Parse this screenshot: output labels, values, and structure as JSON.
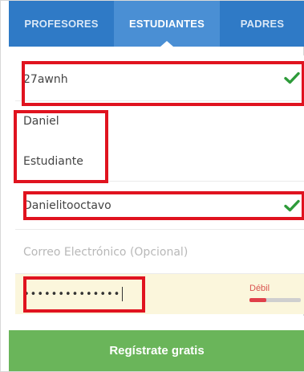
{
  "tabs": [
    {
      "label": "PROFESORES"
    },
    {
      "label": "ESTUDIANTES",
      "active": true
    },
    {
      "label": "PADRES"
    }
  ],
  "form": {
    "class_code": {
      "value": "27awnh",
      "valid": true
    },
    "first_name": {
      "value": "Daniel"
    },
    "last_name": {
      "value": "Estudiante"
    },
    "username": {
      "value": "Danielitooctavo",
      "valid": true
    },
    "email": {
      "placeholder": "Correo Electrónico (Opcional)",
      "value": ""
    },
    "password": {
      "masked": "••••••••••••••",
      "strength_label": "Débil",
      "strength_level": 0.33
    }
  },
  "submit": {
    "label": "Regístrate gratis"
  },
  "colors": {
    "tabs_bg": "#2f7ac6",
    "active_tab_bg": "#4a8fd4",
    "valid_check": "#2e9b3a",
    "weak_strength": "#e0404a",
    "submit_bg": "#6ab55a",
    "annotation": "#e0131f"
  },
  "icons": {
    "valid": "checkmark-icon"
  }
}
